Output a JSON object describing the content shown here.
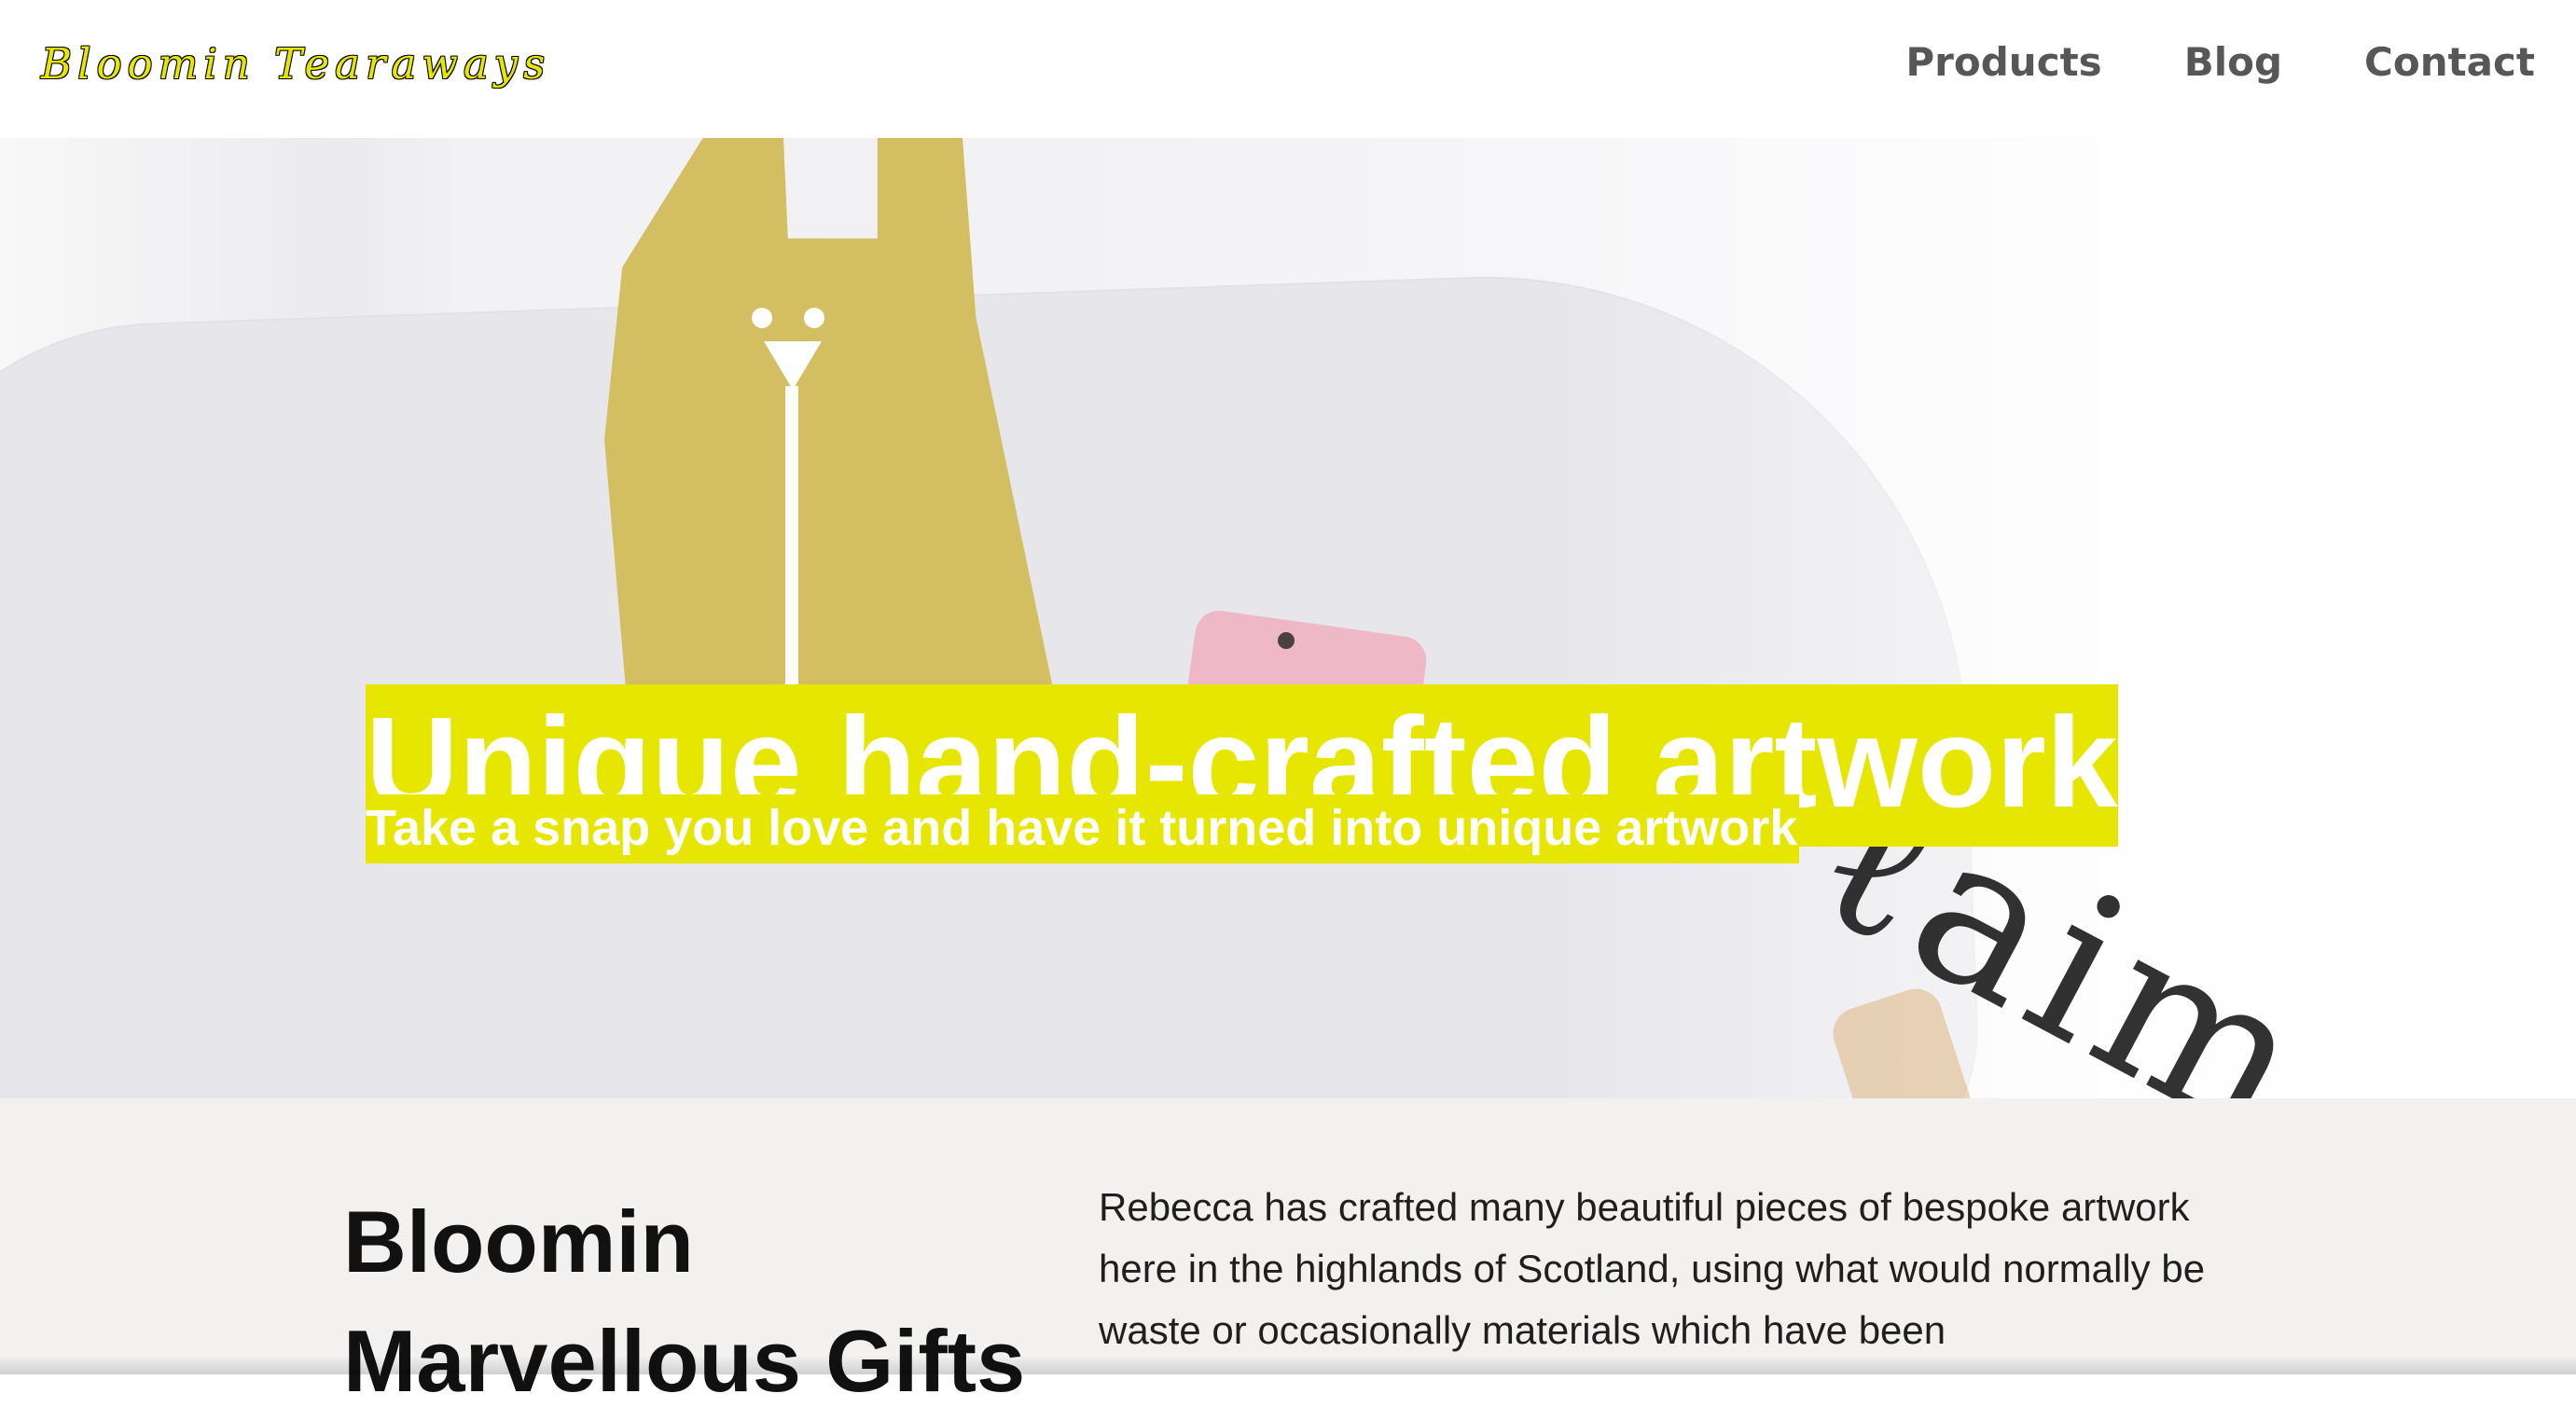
{
  "brand": {
    "name": "Bloomin Tearaways",
    "accent_color": "#e6e600"
  },
  "nav": {
    "items": [
      {
        "label": "Products"
      },
      {
        "label": "Blog"
      },
      {
        "label": "Contact"
      }
    ],
    "text_color": "#575757"
  },
  "hero": {
    "title": "Unique hand-crafted artwork",
    "subtitle": "Take a snap you love and have it turned into unique artwork",
    "highlight_color": "#e6e600",
    "text_color": "#ffffff"
  },
  "about": {
    "heading": "Bloomin Marvellous Gifts",
    "body": "Rebecca has crafted many beautiful pieces of bespoke artwork here in the highlands of Scotland, using what would normally be waste or occasionally materials which have been",
    "background_color": "#f2f1f0"
  }
}
